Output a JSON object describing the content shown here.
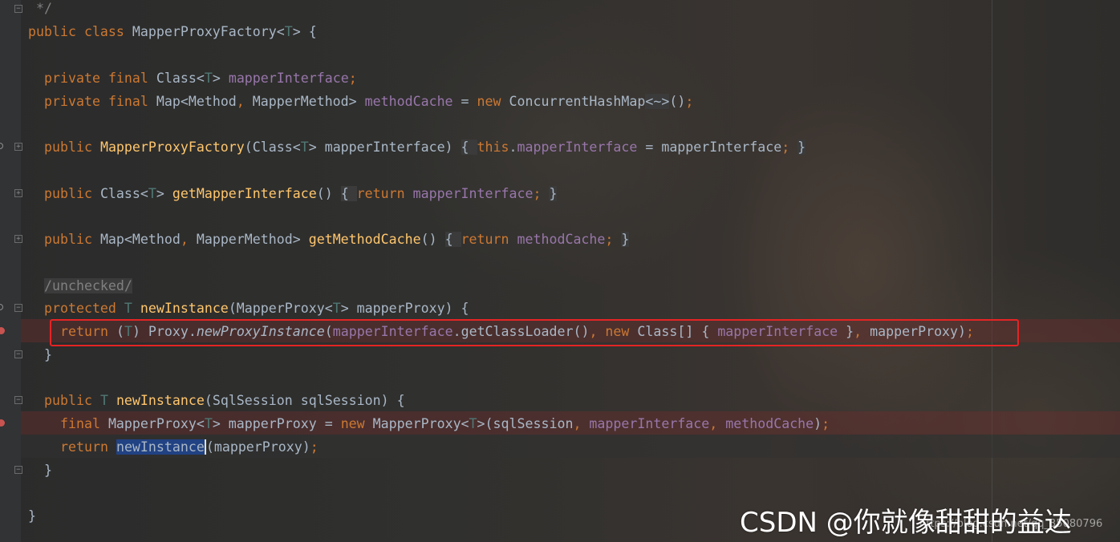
{
  "editor": {
    "language": "java",
    "lines": {
      "l1": {
        "comment_end": "*/"
      },
      "l2": {
        "kw1": "public",
        "kw2": "class",
        "name": "MapperProxyFactory",
        "lt": "<",
        "tp": "T",
        "rest": "> {"
      },
      "l4": {
        "kw1": "private",
        "kw2": "final",
        "type": "Class<",
        "tp": "T",
        "close": "> ",
        "field": "mapperInterface",
        "semi": ";"
      },
      "l5": {
        "kw1": "private",
        "kw2": "final",
        "type": "Map<Method",
        "comma": ", ",
        "type2": "MapperMethod> ",
        "field": "methodCache",
        "eq": " = ",
        "kw3": "new",
        "ctor": " ConcurrentHashMap",
        "diamond": "<~>",
        "end": "()",
        "semi": ";"
      },
      "l7": {
        "kw1": "public",
        "name": "MapperProxyFactory",
        "p1": "(Class<",
        "tp": "T",
        "p2": "> mapperInterface) ",
        "ob": "{ ",
        "kw2": "this",
        "dot": ".",
        "field": "mapperInterface",
        "p3": " = mapperInterface",
        "semi": "; ",
        "cb": "}"
      },
      "l9": {
        "kw1": "public",
        "t1": " Class<",
        "tp": "T",
        "t2": "> ",
        "name": "getMapperInterface",
        "p": "() ",
        "ob": "{ ",
        "kw2": "return",
        "field": " mapperInterface",
        "semi": "; ",
        "cb": "}"
      },
      "l11": {
        "kw1": "public",
        "t1": " Map<Method",
        "comma": ", ",
        "t2": "MapperMethod> ",
        "name": "getMethodCache",
        "p": "() ",
        "ob": "{ ",
        "kw2": "return",
        "field": " methodCache",
        "semi": "; ",
        "cb": "}"
      },
      "l13": {
        "comment": "/unchecked/"
      },
      "l14": {
        "kw1": "protected",
        "tp": " T ",
        "name": "newInstance",
        "p1": "(MapperProxy<",
        "tp2": "T",
        "p2": "> mapperProxy) {"
      },
      "l15": {
        "kw1": "return",
        "p1": " (",
        "tp": "T",
        "p2": ") Proxy.",
        "method": "newProxyInstance",
        "p3": "(",
        "field1": "mapperInterface",
        "p4": ".getClassLoader()",
        "comma1": ", ",
        "kw2": "new",
        "p5": " Class[] { ",
        "field2": "mapperInterface",
        "p6": " }",
        "comma2": ", ",
        "p7": "mapperProxy)",
        "semi": ";"
      },
      "l16": {
        "text": "}"
      },
      "l18": {
        "kw1": "public",
        "tp": " T ",
        "name": "newInstance",
        "p": "(SqlSession sqlSession) {"
      },
      "l19": {
        "kw1": "final",
        "t1": " MapperProxy<",
        "tp": "T",
        "t2": "> mapperProxy = ",
        "kw2": "new",
        "t3": " MapperProxy<",
        "tp2": "T",
        "t4": ">(sqlSession",
        "comma1": ", ",
        "field1": "mapperInterface",
        "comma2": ", ",
        "field2": "methodCache",
        "p": ")",
        "semi": ";"
      },
      "l20": {
        "kw1": "return",
        "sp": " ",
        "sel": "newInstance",
        "p": "(mapperProxy)",
        "semi": ";"
      },
      "l21": {
        "text": "}"
      },
      "l23": {
        "text": "}"
      }
    }
  },
  "annotation": {
    "color": "#e52424"
  },
  "watermark": {
    "text": "CSDN @你就像甜甜的益达",
    "small_text": "https://blog.csdn.net/qq_35080796"
  },
  "colors": {
    "keyword": "#cc7832",
    "field": "#9876aa",
    "method": "#ffc66d",
    "type_param": "#507874",
    "comment": "#808080",
    "text": "#a9b7c6"
  }
}
